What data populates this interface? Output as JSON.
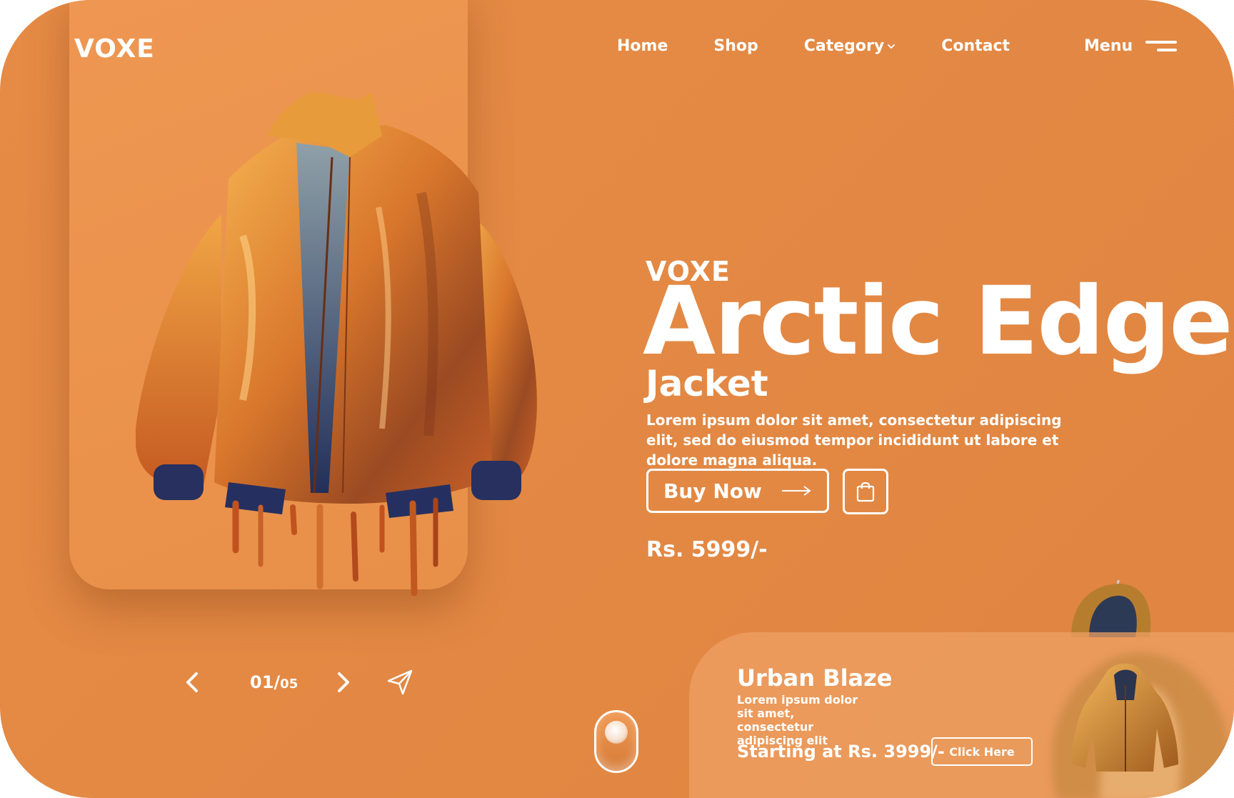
{
  "brand": "VOXE",
  "nav": {
    "items": [
      "Home",
      "Shop",
      "Category",
      "Contact"
    ],
    "menu_label": "Menu"
  },
  "hero": {
    "brand": "VOXE",
    "title": "Arctic Edge",
    "subtitle": "Jacket",
    "description": "Lorem ipsum dolor sit amet, consectetur adipiscing elit, sed do eiusmod tempor incididunt ut labore et dolore magna aliqua.",
    "buy_label": "Buy Now",
    "price": "Rs. 5999/-"
  },
  "slider": {
    "current": "01",
    "separator": "/",
    "total": "05"
  },
  "promo": {
    "title": "Urban Blaze",
    "description": "Lorem ipsum dolor sit amet, consectetur adipiscing elit",
    "price": "Starting at Rs. 3999/-",
    "button_label": "Click Here"
  },
  "icons": {
    "menu": "hamburger-icon",
    "category": "chevron-down-icon",
    "buy": "arrow-right-icon",
    "bag": "shopping-bag-icon",
    "prev": "chevron-left-icon",
    "next": "chevron-right-icon",
    "share": "send-icon"
  },
  "colors": {
    "background": "#e38944",
    "card": "#ec954f",
    "text": "#ffffff"
  }
}
